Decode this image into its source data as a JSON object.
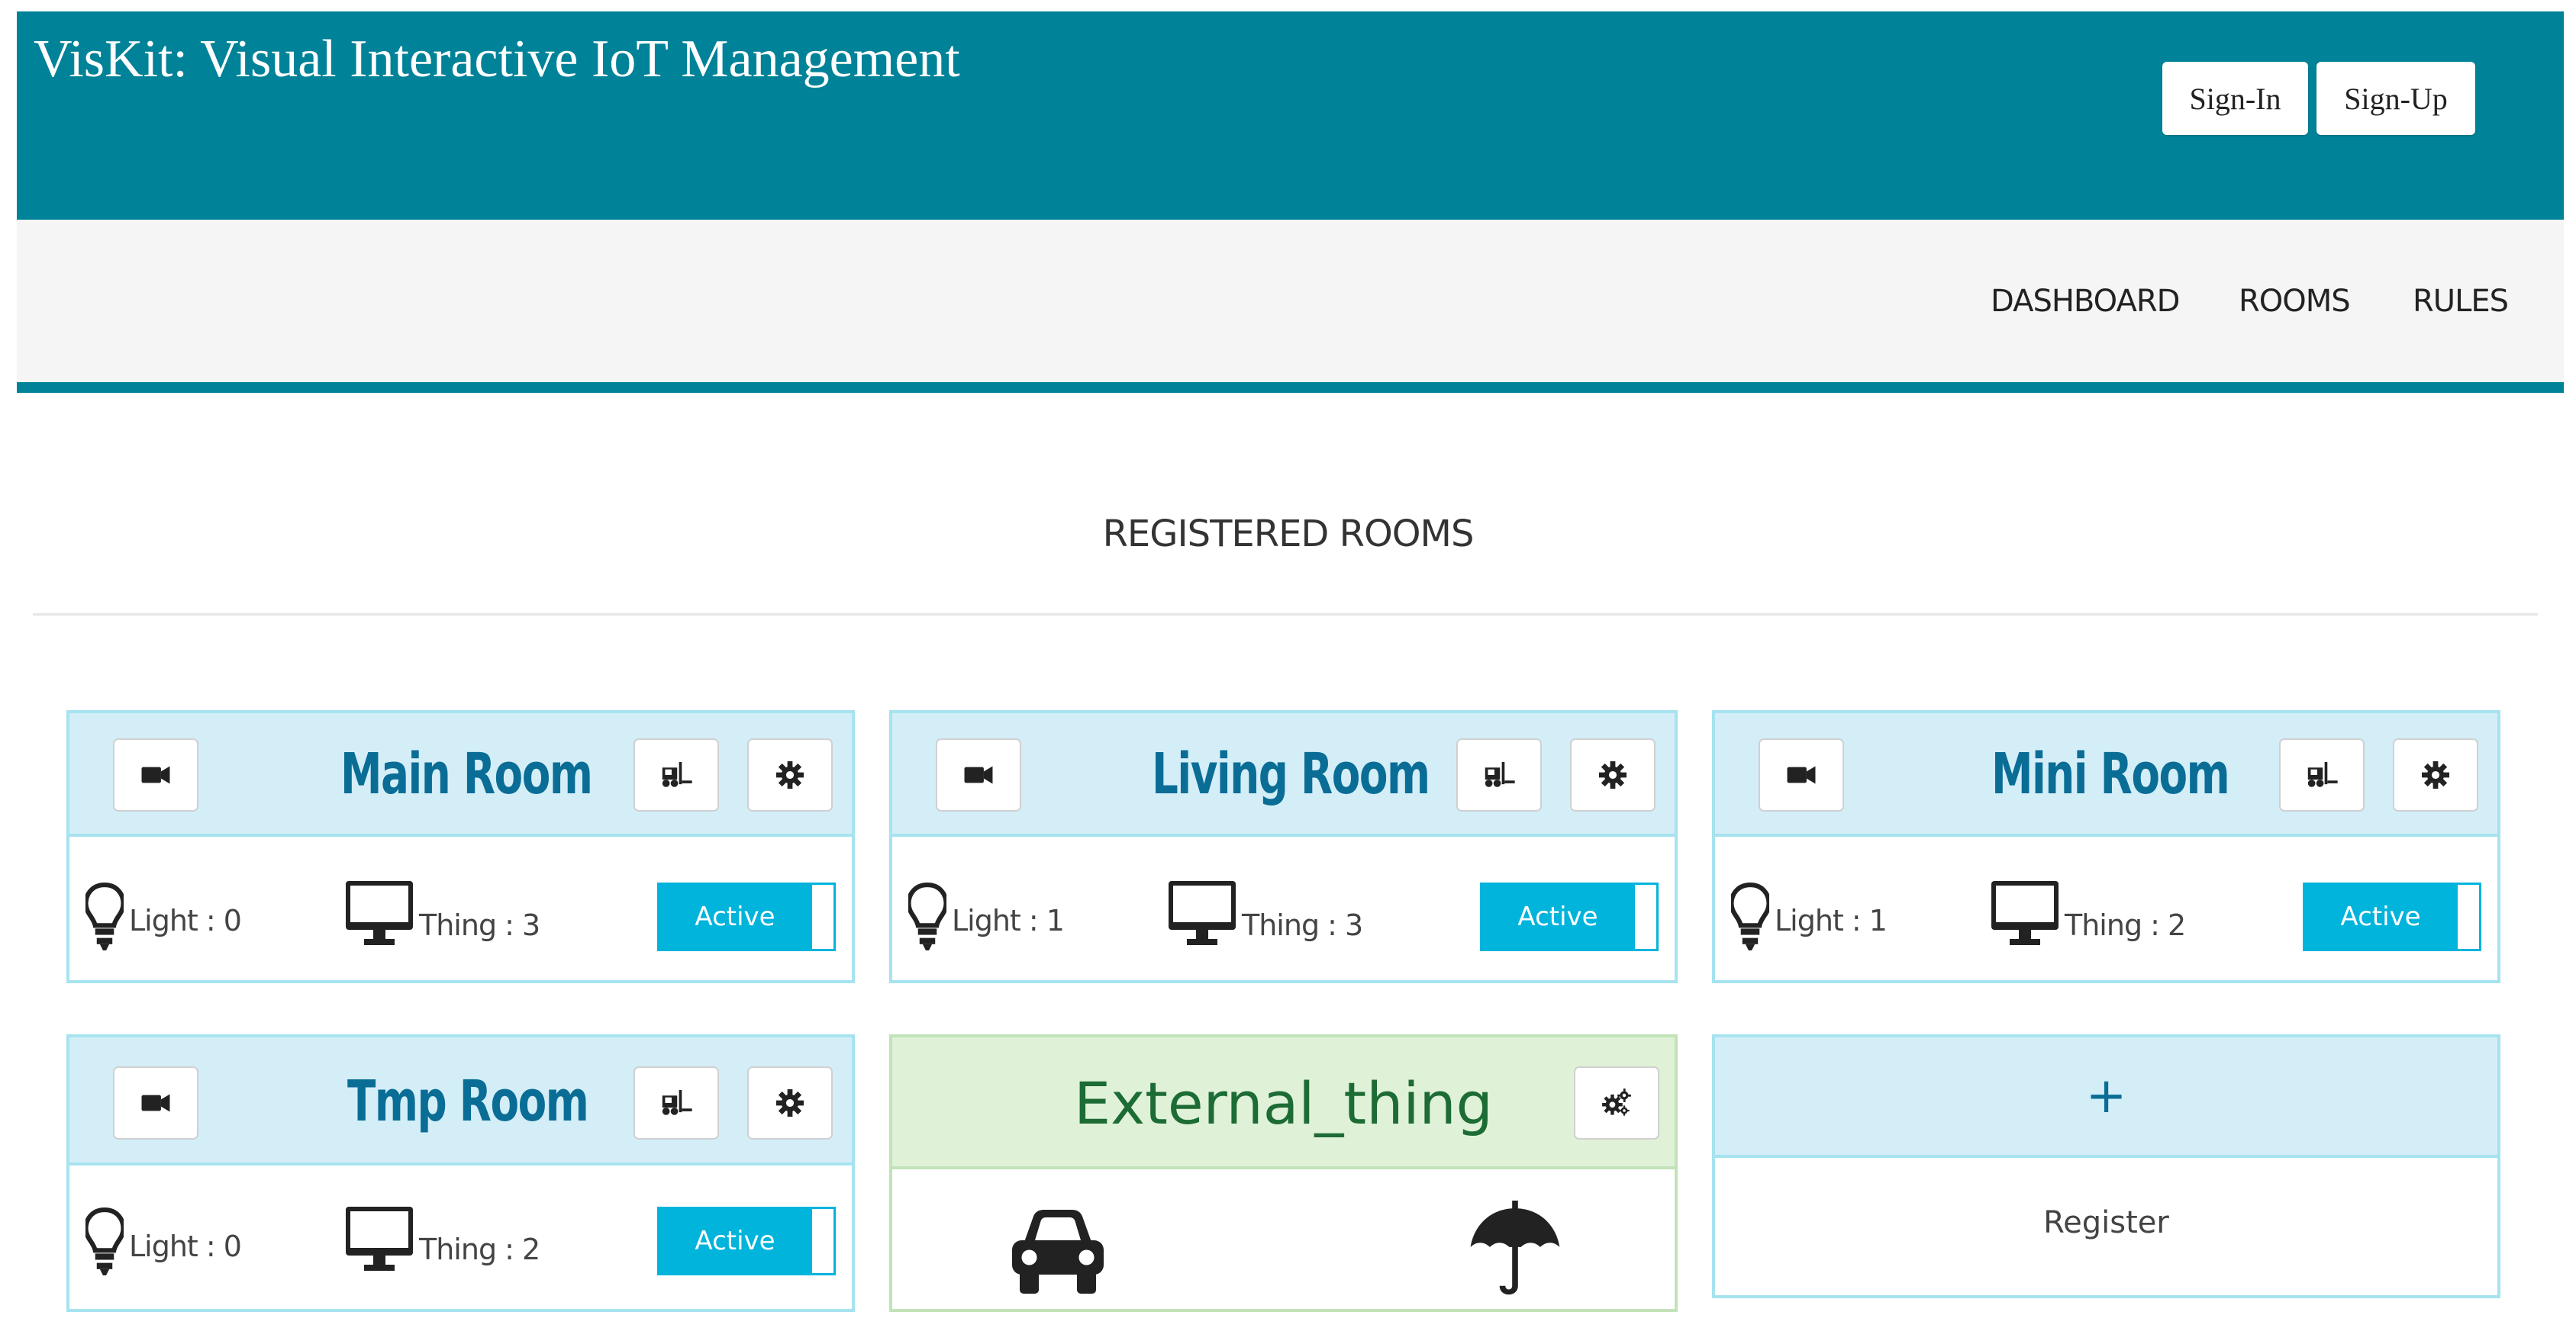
{
  "header": {
    "title": "VisKit: Visual Interactive IoT Management",
    "sign_in": "Sign-In",
    "sign_up": "Sign-Up",
    "bg_color": "#008299"
  },
  "nav": {
    "items": [
      "DASHBOARD",
      "ROOMS",
      "RULES"
    ]
  },
  "section_title": "REGISTERED ROOMS",
  "rooms": [
    {
      "name": "Main Room",
      "light": "Light : 0",
      "thing": "Thing : 3",
      "status": "Active"
    },
    {
      "name": "Living Room",
      "light": "Light : 1",
      "thing": "Thing : 3",
      "status": "Active"
    },
    {
      "name": "Mini Room",
      "light": "Light : 1",
      "thing": "Thing : 2",
      "status": "Active"
    },
    {
      "name": "Tmp Room",
      "light": "Light : 0",
      "thing": "Thing : 2",
      "status": "Active"
    }
  ],
  "external": {
    "name": "External_thing",
    "icons": [
      "car-icon",
      "umbrella-icon"
    ]
  },
  "register": {
    "plus": "+",
    "label": "Register"
  },
  "colors": {
    "accent": "#008299",
    "room_title": "#0a6d96",
    "toggle": "#00b4dc",
    "external_title": "#1d6b35"
  }
}
